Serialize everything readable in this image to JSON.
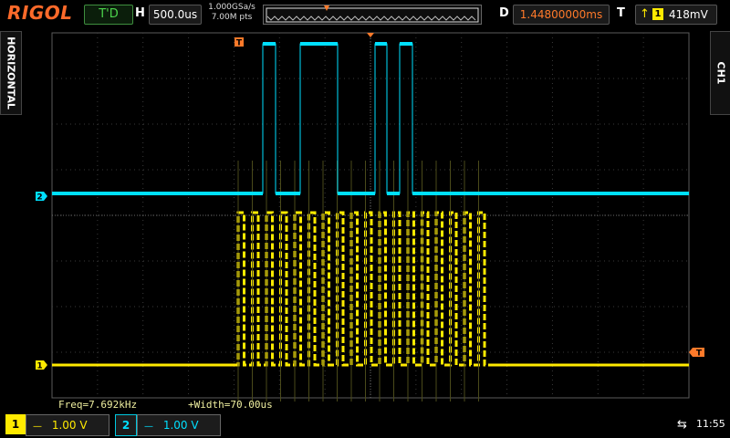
{
  "header": {
    "brand": "RIGOL",
    "run_status": "T'D",
    "h_label": "H",
    "timebase": "500.0us",
    "sample_rate": "1.000GSa/s",
    "memory_depth": "7.00M pts",
    "d_label": "D",
    "delay": "1.44800000ms",
    "t_label": "T",
    "trigger_source": "1",
    "trigger_level": "418mV"
  },
  "side_tabs": {
    "left": "HORIZONTAL",
    "right": "CH1"
  },
  "channel_markers": {
    "ch1": "1",
    "ch2": "2",
    "trigger_marker": "T"
  },
  "measurements": {
    "freq": "Freq=7.692kHz",
    "width": "+Width=70.00us"
  },
  "footer": {
    "ch1": {
      "number": "1",
      "coupling": "—",
      "scale": "1.00 V"
    },
    "ch2": {
      "number": "2",
      "coupling": "—",
      "scale": "1.00 V"
    },
    "clock": "11:55"
  },
  "colors": {
    "ch1": "#ffea00",
    "ch2": "#00e0ff",
    "trigger": "#ff7a2a",
    "brand": "#ff6a2a"
  },
  "icons": {
    "usb": "usb-icon",
    "trigger_edge": "rising-edge-icon"
  }
}
